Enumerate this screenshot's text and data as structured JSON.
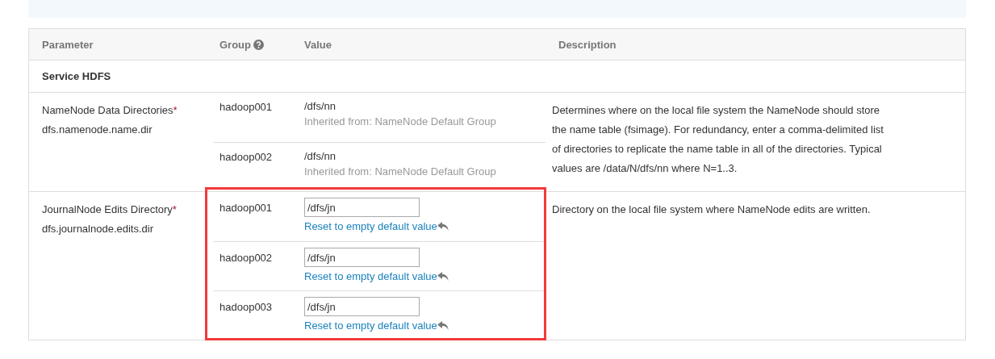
{
  "table": {
    "columns": [
      {
        "label": "Parameter",
        "help": false
      },
      {
        "label": "Group",
        "help": true
      },
      {
        "label": "Value",
        "help": false
      },
      {
        "label": "Description",
        "help": false
      }
    ],
    "sections": [
      {
        "title": "Service HDFS"
      }
    ],
    "parameters": [
      {
        "name": "NameNode Data Directories",
        "required": "*",
        "key": "dfs.namenode.name.dir",
        "highlighted": false,
        "description": "Determines where on the local file system the NameNode should store the name table (fsimage). For redundancy, enter a comma-delimited list of directories to replicate the name table in all of the directories. Typical values are /data/N/dfs/nn where N=1..3.",
        "groups": [
          {
            "kind": "inherited",
            "group": "hadoop001",
            "value": "/dfs/nn",
            "note": "Inherited from: NameNode Default Group"
          },
          {
            "kind": "inherited",
            "group": "hadoop002",
            "value": "/dfs/nn",
            "note": "Inherited from: NameNode Default Group"
          }
        ]
      },
      {
        "name": "JournalNode Edits Directory",
        "required": "*",
        "key": "dfs.journalnode.edits.dir",
        "highlighted": true,
        "description": "Directory on the local file system where NameNode edits are written.",
        "groups": [
          {
            "kind": "editable",
            "group": "hadoop001",
            "value": "/dfs/jn",
            "note": "Reset to empty default value"
          },
          {
            "kind": "editable",
            "group": "hadoop002",
            "value": "/dfs/jn",
            "note": "Reset to empty default value"
          },
          {
            "kind": "editable",
            "group": "hadoop003",
            "value": "/dfs/jn",
            "note": "Reset to empty default value"
          }
        ]
      }
    ]
  }
}
